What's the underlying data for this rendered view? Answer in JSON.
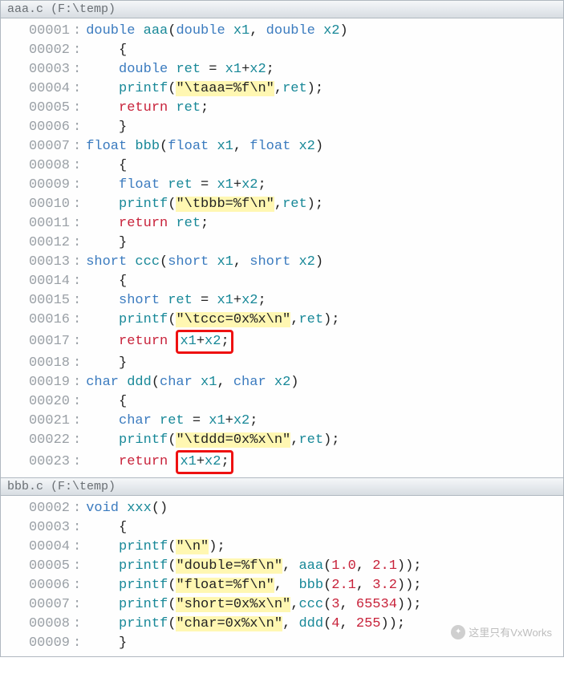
{
  "panes": [
    {
      "title": "aaa.c (F:\\temp)",
      "lines": [
        {
          "num": "00001",
          "tokens": [
            {
              "t": "kw",
              "v": "double"
            },
            {
              "t": "sp",
              "v": " "
            },
            {
              "t": "ident",
              "v": "aaa"
            },
            {
              "t": "op",
              "v": "("
            },
            {
              "t": "kw",
              "v": "double"
            },
            {
              "t": "sp",
              "v": " "
            },
            {
              "t": "ident",
              "v": "x1"
            },
            {
              "t": "op",
              "v": ", "
            },
            {
              "t": "kw",
              "v": "double"
            },
            {
              "t": "sp",
              "v": " "
            },
            {
              "t": "ident",
              "v": "x2"
            },
            {
              "t": "op",
              "v": ")"
            }
          ]
        },
        {
          "num": "00002",
          "tokens": [
            {
              "t": "sp",
              "v": "    "
            },
            {
              "t": "op",
              "v": "{"
            }
          ]
        },
        {
          "num": "00003",
          "tokens": [
            {
              "t": "sp",
              "v": "    "
            },
            {
              "t": "kw",
              "v": "double"
            },
            {
              "t": "sp",
              "v": " "
            },
            {
              "t": "ident",
              "v": "ret"
            },
            {
              "t": "sp",
              "v": " "
            },
            {
              "t": "op",
              "v": "= "
            },
            {
              "t": "ident",
              "v": "x1"
            },
            {
              "t": "op",
              "v": "+"
            },
            {
              "t": "ident",
              "v": "x2"
            },
            {
              "t": "op",
              "v": ";"
            }
          ]
        },
        {
          "num": "00004",
          "tokens": [
            {
              "t": "sp",
              "v": "    "
            },
            {
              "t": "ident",
              "v": "printf"
            },
            {
              "t": "op",
              "v": "("
            },
            {
              "t": "str",
              "v": "\"\\taaa=%f\\n\""
            },
            {
              "t": "op",
              "v": ","
            },
            {
              "t": "ident",
              "v": "ret"
            },
            {
              "t": "op",
              "v": ");"
            }
          ]
        },
        {
          "num": "00005",
          "tokens": [
            {
              "t": "sp",
              "v": "    "
            },
            {
              "t": "ret",
              "v": "return"
            },
            {
              "t": "sp",
              "v": " "
            },
            {
              "t": "ident",
              "v": "ret"
            },
            {
              "t": "op",
              "v": ";"
            }
          ]
        },
        {
          "num": "00006",
          "tokens": [
            {
              "t": "sp",
              "v": "    "
            },
            {
              "t": "op",
              "v": "}"
            }
          ]
        },
        {
          "num": "00007",
          "tokens": [
            {
              "t": "kw",
              "v": "float"
            },
            {
              "t": "sp",
              "v": " "
            },
            {
              "t": "ident",
              "v": "bbb"
            },
            {
              "t": "op",
              "v": "("
            },
            {
              "t": "kw",
              "v": "float"
            },
            {
              "t": "sp",
              "v": " "
            },
            {
              "t": "ident",
              "v": "x1"
            },
            {
              "t": "op",
              "v": ", "
            },
            {
              "t": "kw",
              "v": "float"
            },
            {
              "t": "sp",
              "v": " "
            },
            {
              "t": "ident",
              "v": "x2"
            },
            {
              "t": "op",
              "v": ")"
            }
          ]
        },
        {
          "num": "00008",
          "tokens": [
            {
              "t": "sp",
              "v": "    "
            },
            {
              "t": "op",
              "v": "{"
            }
          ]
        },
        {
          "num": "00009",
          "tokens": [
            {
              "t": "sp",
              "v": "    "
            },
            {
              "t": "kw",
              "v": "float"
            },
            {
              "t": "sp",
              "v": " "
            },
            {
              "t": "ident",
              "v": "ret"
            },
            {
              "t": "sp",
              "v": " "
            },
            {
              "t": "op",
              "v": "= "
            },
            {
              "t": "ident",
              "v": "x1"
            },
            {
              "t": "op",
              "v": "+"
            },
            {
              "t": "ident",
              "v": "x2"
            },
            {
              "t": "op",
              "v": ";"
            }
          ]
        },
        {
          "num": "00010",
          "tokens": [
            {
              "t": "sp",
              "v": "    "
            },
            {
              "t": "ident",
              "v": "printf"
            },
            {
              "t": "op",
              "v": "("
            },
            {
              "t": "str",
              "v": "\"\\tbbb=%f\\n\""
            },
            {
              "t": "op",
              "v": ","
            },
            {
              "t": "ident",
              "v": "ret"
            },
            {
              "t": "op",
              "v": ");"
            }
          ]
        },
        {
          "num": "00011",
          "tokens": [
            {
              "t": "sp",
              "v": "    "
            },
            {
              "t": "ret",
              "v": "return"
            },
            {
              "t": "sp",
              "v": " "
            },
            {
              "t": "ident",
              "v": "ret"
            },
            {
              "t": "op",
              "v": ";"
            }
          ]
        },
        {
          "num": "00012",
          "tokens": [
            {
              "t": "sp",
              "v": "    "
            },
            {
              "t": "op",
              "v": "}"
            }
          ]
        },
        {
          "num": "00013",
          "tokens": [
            {
              "t": "kw",
              "v": "short"
            },
            {
              "t": "sp",
              "v": " "
            },
            {
              "t": "ident",
              "v": "ccc"
            },
            {
              "t": "op",
              "v": "("
            },
            {
              "t": "kw",
              "v": "short"
            },
            {
              "t": "sp",
              "v": " "
            },
            {
              "t": "ident",
              "v": "x1"
            },
            {
              "t": "op",
              "v": ", "
            },
            {
              "t": "kw",
              "v": "short"
            },
            {
              "t": "sp",
              "v": " "
            },
            {
              "t": "ident",
              "v": "x2"
            },
            {
              "t": "op",
              "v": ")"
            }
          ]
        },
        {
          "num": "00014",
          "tokens": [
            {
              "t": "sp",
              "v": "    "
            },
            {
              "t": "op",
              "v": "{"
            }
          ]
        },
        {
          "num": "00015",
          "tokens": [
            {
              "t": "sp",
              "v": "    "
            },
            {
              "t": "kw",
              "v": "short"
            },
            {
              "t": "sp",
              "v": " "
            },
            {
              "t": "ident",
              "v": "ret"
            },
            {
              "t": "sp",
              "v": " "
            },
            {
              "t": "op",
              "v": "= "
            },
            {
              "t": "ident",
              "v": "x1"
            },
            {
              "t": "op",
              "v": "+"
            },
            {
              "t": "ident",
              "v": "x2"
            },
            {
              "t": "op",
              "v": ";"
            }
          ]
        },
        {
          "num": "00016",
          "tokens": [
            {
              "t": "sp",
              "v": "    "
            },
            {
              "t": "ident",
              "v": "printf"
            },
            {
              "t": "op",
              "v": "("
            },
            {
              "t": "str",
              "v": "\"\\tccc=0x%x\\n\""
            },
            {
              "t": "op",
              "v": ","
            },
            {
              "t": "ident",
              "v": "ret"
            },
            {
              "t": "op",
              "v": ");"
            }
          ]
        },
        {
          "num": "00017",
          "tokens": [
            {
              "t": "sp",
              "v": "    "
            },
            {
              "t": "ret",
              "v": "return"
            },
            {
              "t": "sp",
              "v": " "
            },
            {
              "t": "redbox",
              "inner": [
                {
                  "t": "ident",
                  "v": "x1"
                },
                {
                  "t": "op",
                  "v": "+"
                },
                {
                  "t": "ident",
                  "v": "x2"
                },
                {
                  "t": "op",
                  "v": ";"
                }
              ]
            }
          ]
        },
        {
          "num": "00018",
          "tokens": [
            {
              "t": "sp",
              "v": "    "
            },
            {
              "t": "op",
              "v": "}"
            }
          ]
        },
        {
          "num": "00019",
          "tokens": [
            {
              "t": "kw",
              "v": "char"
            },
            {
              "t": "sp",
              "v": " "
            },
            {
              "t": "ident",
              "v": "ddd"
            },
            {
              "t": "op",
              "v": "("
            },
            {
              "t": "kw",
              "v": "char"
            },
            {
              "t": "sp",
              "v": " "
            },
            {
              "t": "ident",
              "v": "x1"
            },
            {
              "t": "op",
              "v": ", "
            },
            {
              "t": "kw",
              "v": "char"
            },
            {
              "t": "sp",
              "v": " "
            },
            {
              "t": "ident",
              "v": "x2"
            },
            {
              "t": "op",
              "v": ")"
            }
          ]
        },
        {
          "num": "00020",
          "tokens": [
            {
              "t": "sp",
              "v": "    "
            },
            {
              "t": "op",
              "v": "{"
            }
          ]
        },
        {
          "num": "00021",
          "tokens": [
            {
              "t": "sp",
              "v": "    "
            },
            {
              "t": "kw",
              "v": "char"
            },
            {
              "t": "sp",
              "v": " "
            },
            {
              "t": "ident",
              "v": "ret"
            },
            {
              "t": "sp",
              "v": " "
            },
            {
              "t": "op",
              "v": "= "
            },
            {
              "t": "ident",
              "v": "x1"
            },
            {
              "t": "op",
              "v": "+"
            },
            {
              "t": "ident",
              "v": "x2"
            },
            {
              "t": "op",
              "v": ";"
            }
          ]
        },
        {
          "num": "00022",
          "tokens": [
            {
              "t": "sp",
              "v": "    "
            },
            {
              "t": "ident",
              "v": "printf"
            },
            {
              "t": "op",
              "v": "("
            },
            {
              "t": "str",
              "v": "\"\\tddd=0x%x\\n\""
            },
            {
              "t": "op",
              "v": ","
            },
            {
              "t": "ident",
              "v": "ret"
            },
            {
              "t": "op",
              "v": ");"
            }
          ]
        },
        {
          "num": "00023",
          "tokens": [
            {
              "t": "sp",
              "v": "    "
            },
            {
              "t": "ret",
              "v": "return"
            },
            {
              "t": "sp",
              "v": " "
            },
            {
              "t": "redbox",
              "inner": [
                {
                  "t": "ident",
                  "v": "x1"
                },
                {
                  "t": "op",
                  "v": "+"
                },
                {
                  "t": "ident",
                  "v": "x2"
                },
                {
                  "t": "op",
                  "v": ";"
                }
              ]
            }
          ]
        }
      ]
    },
    {
      "title": "bbb.c (F:\\temp)",
      "lines": [
        {
          "num": "00002",
          "tokens": [
            {
              "t": "kw",
              "v": "void"
            },
            {
              "t": "sp",
              "v": " "
            },
            {
              "t": "ident",
              "v": "xxx"
            },
            {
              "t": "op",
              "v": "()"
            }
          ]
        },
        {
          "num": "00003",
          "tokens": [
            {
              "t": "sp",
              "v": "    "
            },
            {
              "t": "op",
              "v": "{"
            }
          ]
        },
        {
          "num": "00004",
          "tokens": [
            {
              "t": "sp",
              "v": "    "
            },
            {
              "t": "ident",
              "v": "printf"
            },
            {
              "t": "op",
              "v": "("
            },
            {
              "t": "str",
              "v": "\"\\n\""
            },
            {
              "t": "op",
              "v": ");"
            }
          ]
        },
        {
          "num": "00005",
          "tokens": [
            {
              "t": "sp",
              "v": "    "
            },
            {
              "t": "ident",
              "v": "printf"
            },
            {
              "t": "op",
              "v": "("
            },
            {
              "t": "str",
              "v": "\"double=%f\\n\""
            },
            {
              "t": "op",
              "v": ", "
            },
            {
              "t": "ident",
              "v": "aaa"
            },
            {
              "t": "op",
              "v": "("
            },
            {
              "t": "num",
              "v": "1.0"
            },
            {
              "t": "op",
              "v": ", "
            },
            {
              "t": "num",
              "v": "2.1"
            },
            {
              "t": "op",
              "v": "));"
            }
          ]
        },
        {
          "num": "00006",
          "tokens": [
            {
              "t": "sp",
              "v": "    "
            },
            {
              "t": "ident",
              "v": "printf"
            },
            {
              "t": "op",
              "v": "("
            },
            {
              "t": "str",
              "v": "\"float=%f\\n\""
            },
            {
              "t": "op",
              "v": ",  "
            },
            {
              "t": "ident",
              "v": "bbb"
            },
            {
              "t": "op",
              "v": "("
            },
            {
              "t": "num",
              "v": "2.1"
            },
            {
              "t": "op",
              "v": ", "
            },
            {
              "t": "num",
              "v": "3.2"
            },
            {
              "t": "op",
              "v": "));"
            }
          ]
        },
        {
          "num": "00007",
          "tokens": [
            {
              "t": "sp",
              "v": "    "
            },
            {
              "t": "ident",
              "v": "printf"
            },
            {
              "t": "op",
              "v": "("
            },
            {
              "t": "str",
              "v": "\"short=0x%x\\n\""
            },
            {
              "t": "op",
              "v": ","
            },
            {
              "t": "ident",
              "v": "ccc"
            },
            {
              "t": "op",
              "v": "("
            },
            {
              "t": "num",
              "v": "3"
            },
            {
              "t": "op",
              "v": ", "
            },
            {
              "t": "num",
              "v": "65534"
            },
            {
              "t": "op",
              "v": "));"
            }
          ]
        },
        {
          "num": "00008",
          "tokens": [
            {
              "t": "sp",
              "v": "    "
            },
            {
              "t": "ident",
              "v": "printf"
            },
            {
              "t": "op",
              "v": "("
            },
            {
              "t": "str",
              "v": "\"char=0x%x\\n\""
            },
            {
              "t": "op",
              "v": ", "
            },
            {
              "t": "ident",
              "v": "ddd"
            },
            {
              "t": "op",
              "v": "("
            },
            {
              "t": "num",
              "v": "4"
            },
            {
              "t": "op",
              "v": ", "
            },
            {
              "t": "num",
              "v": "255"
            },
            {
              "t": "op",
              "v": "));"
            }
          ]
        },
        {
          "num": "00009",
          "tokens": [
            {
              "t": "sp",
              "v": "    "
            },
            {
              "t": "op",
              "v": "}"
            }
          ]
        }
      ]
    }
  ],
  "watermark": "这里只有VxWorks"
}
